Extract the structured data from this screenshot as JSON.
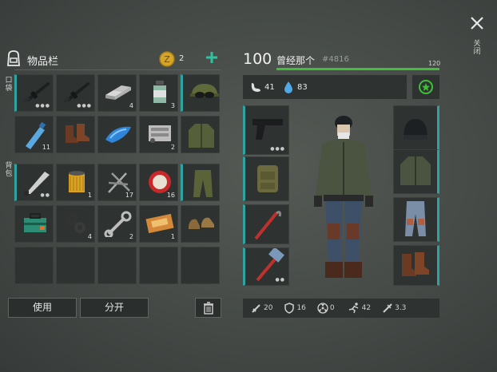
{
  "inventory": {
    "title": "物品栏",
    "coins": "2",
    "pockets_label": "口袋",
    "backpack_label": "背包",
    "items": [
      {
        "name": "rifle",
        "qty": "",
        "dots": "●●●"
      },
      {
        "name": "rifle",
        "qty": "",
        "dots": "●●●"
      },
      {
        "name": "metal-bars",
        "qty": "4",
        "dots": ""
      },
      {
        "name": "pill-bottle",
        "qty": "3",
        "dots": ""
      },
      {
        "name": "cap-with-goggles",
        "qty": "",
        "dots": ""
      },
      {
        "name": "water-bottle",
        "qty": "11",
        "dots": ""
      },
      {
        "name": "boots",
        "qty": "",
        "dots": ""
      },
      {
        "name": "blue-gem",
        "qty": "",
        "dots": ""
      },
      {
        "name": "engine-part",
        "qty": "2",
        "dots": ""
      },
      {
        "name": "jacket",
        "qty": "",
        "dots": ""
      },
      {
        "name": "machete",
        "qty": "",
        "dots": "●●"
      },
      {
        "name": "filter",
        "qty": "1",
        "dots": ""
      },
      {
        "name": "nails",
        "qty": "17",
        "dots": ""
      },
      {
        "name": "bottle-cap",
        "qty": "16",
        "dots": ""
      },
      {
        "name": "pants",
        "qty": "",
        "dots": ""
      },
      {
        "name": "toolbox",
        "qty": "",
        "dots": ""
      },
      {
        "name": "washers",
        "qty": "4",
        "dots": ""
      },
      {
        "name": "wrench",
        "qty": "2",
        "dots": ""
      },
      {
        "name": "coupon",
        "qty": "1",
        "dots": ""
      },
      {
        "name": "shoes",
        "qty": "",
        "dots": ""
      }
    ],
    "use_label": "使用",
    "split_label": "分开"
  },
  "character": {
    "level": "100",
    "name": "曾经那个",
    "id_tag": "#4816",
    "xp_max": "120",
    "xp_fraction": 1.0,
    "food": "41",
    "water": "83",
    "stats": {
      "attack": "20",
      "defense": "16",
      "radiation": "0",
      "speed": "42",
      "accuracy": "3.3"
    },
    "weapon_dots": "●●●",
    "hammer_dots": "●●"
  },
  "close_label": "关闭",
  "colors": {
    "accent": "#2fa3a0",
    "xp_bar": "#3fbf3a",
    "plus": "#2fc2a0"
  }
}
